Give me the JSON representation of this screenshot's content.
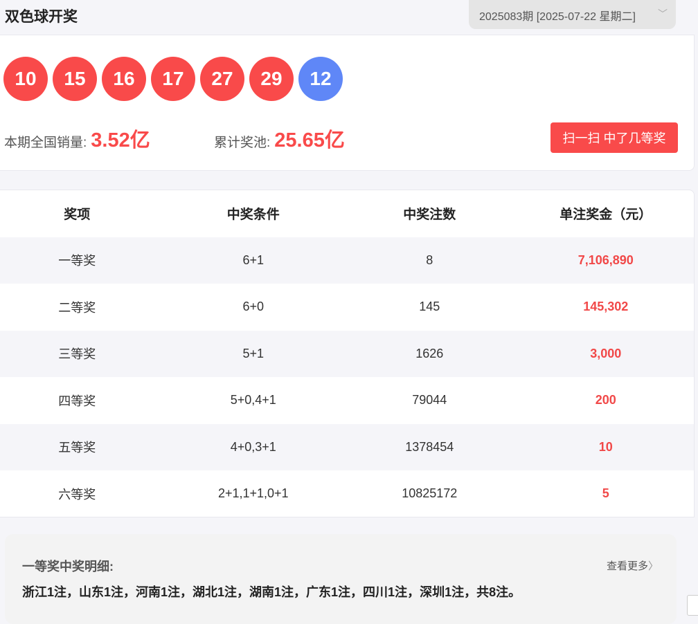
{
  "header": {
    "title": "双色球开奖",
    "issue": "2025083期 [2025-07-22 星期二]"
  },
  "draw": {
    "red_balls": [
      "10",
      "15",
      "16",
      "17",
      "27",
      "29"
    ],
    "blue_ball": "12",
    "red_color": "#f94a4a",
    "blue_color": "#5f87f7"
  },
  "stats": {
    "sales_label": "本期全国销量:",
    "sales_value": "3.52亿",
    "pool_label": "累计奖池:",
    "pool_value": "25.65亿",
    "accent": "#f94a4a"
  },
  "scan_button": "扫一扫 中了几等奖",
  "table": {
    "headers": [
      "奖项",
      "中奖条件",
      "中奖注数",
      "单注奖金（元）"
    ],
    "rows": [
      [
        "一等奖",
        "6+1",
        "8",
        "7,106,890"
      ],
      [
        "二等奖",
        "6+0",
        "145",
        "145,302"
      ],
      [
        "三等奖",
        "5+1",
        "1626",
        "3,000"
      ],
      [
        "四等奖",
        "5+0,4+1",
        "79044",
        "200"
      ],
      [
        "五等奖",
        "4+0,3+1",
        "1378454",
        "10"
      ],
      [
        "六等奖",
        "2+1,1+1,0+1",
        "10825172",
        "5"
      ]
    ]
  },
  "detail": {
    "title": "一等奖中奖明细:",
    "more": "查看更多",
    "text": "浙江1注，山东1注，河南1注，湖北1注，湖南1注，广东1注，四川1注，深圳1注，共8注。"
  }
}
